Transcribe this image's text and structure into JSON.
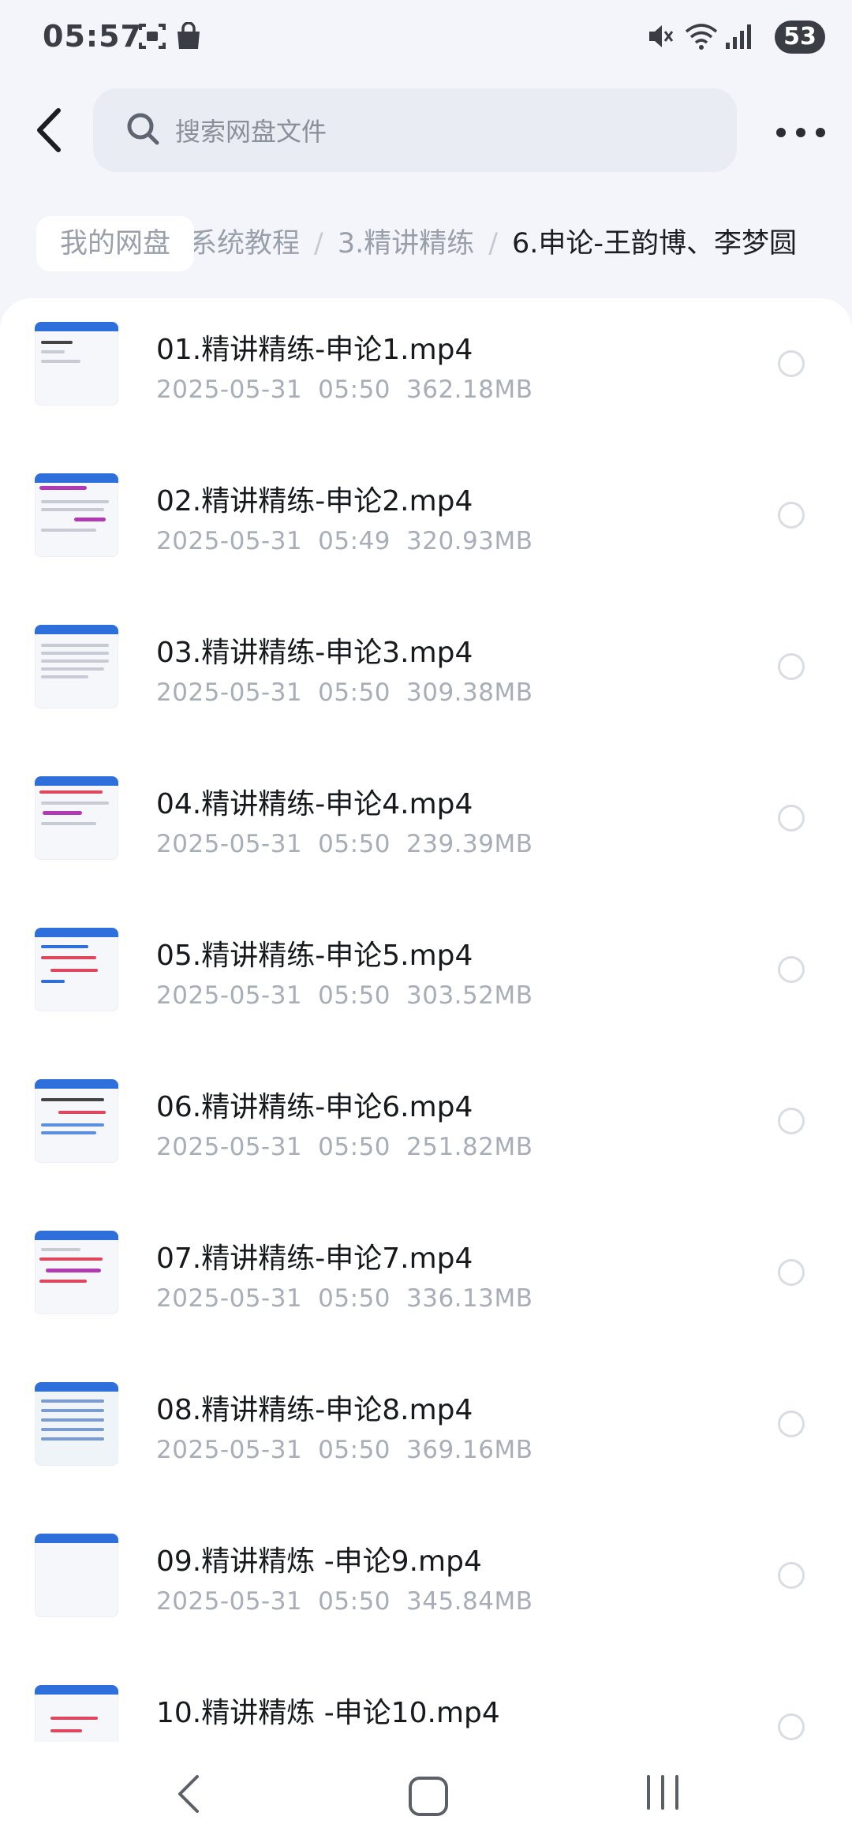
{
  "status_bar": {
    "time": "05:57",
    "battery": "53"
  },
  "search": {
    "placeholder": "搜索网盘文件"
  },
  "breadcrumb": {
    "root": "我的网盘",
    "items": [
      "系统教程",
      "3.精讲精练"
    ],
    "current": "6.申论-王韵博、李梦圆",
    "separator": "/"
  },
  "files": [
    {
      "name": "01.精讲精练-申论1.mp4",
      "date": "2025-05-31",
      "time": "05:50",
      "size": "362.18MB"
    },
    {
      "name": "02.精讲精练-申论2.mp4",
      "date": "2025-05-31",
      "time": "05:49",
      "size": "320.93MB"
    },
    {
      "name": "03.精讲精练-申论3.mp4",
      "date": "2025-05-31",
      "time": "05:50",
      "size": "309.38MB"
    },
    {
      "name": "04.精讲精练-申论4.mp4",
      "date": "2025-05-31",
      "time": "05:50",
      "size": "239.39MB"
    },
    {
      "name": "05.精讲精练-申论5.mp4",
      "date": "2025-05-31",
      "time": "05:50",
      "size": "303.52MB"
    },
    {
      "name": "06.精讲精练-申论6.mp4",
      "date": "2025-05-31",
      "time": "05:50",
      "size": "251.82MB"
    },
    {
      "name": "07.精讲精练-申论7.mp4",
      "date": "2025-05-31",
      "time": "05:50",
      "size": "336.13MB"
    },
    {
      "name": "08.精讲精练-申论8.mp4",
      "date": "2025-05-31",
      "time": "05:50",
      "size": "369.16MB"
    },
    {
      "name": "09.精讲精炼 -申论9.mp4",
      "date": "2025-05-31",
      "time": "05:50",
      "size": "345.84MB"
    },
    {
      "name": "10.精讲精炼 -申论10.mp4",
      "date": "",
      "time": "",
      "size": ""
    }
  ],
  "icons": {
    "back": "chevron-left-icon",
    "search": "search-icon",
    "more": "more-horizontal-icon",
    "status": [
      "screenshot-icon",
      "shopping-bag-icon",
      "mute-icon",
      "wifi-icon",
      "signal-icon"
    ],
    "nav": [
      "nav-back-icon",
      "nav-home-icon",
      "nav-recents-icon"
    ]
  },
  "colors": {
    "accent": "#2f6fdc",
    "muted_text": "#a8aeb8"
  }
}
